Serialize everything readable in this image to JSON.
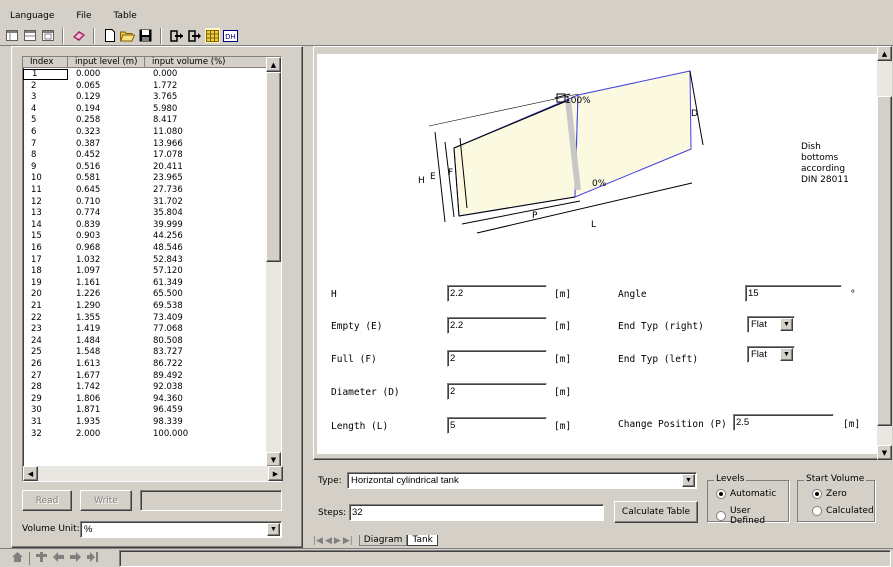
{
  "menu": [
    "Language",
    "File",
    "Table"
  ],
  "toolbar": {
    "icons": [
      "layout-grid-icon",
      "layout-table-icon",
      "layout-window-icon",
      "book-icon",
      "new-file-icon",
      "open-folder-icon",
      "save-icon",
      "export-icon",
      "import-icon",
      "table-grid-icon",
      "dh-icon"
    ],
    "dh_label": "DH"
  },
  "table": {
    "headers": [
      "Index",
      "input level (m)",
      "input volume (%)"
    ],
    "rows": [
      [
        "1",
        "0.000",
        "0.000"
      ],
      [
        "2",
        "0.065",
        "1.772"
      ],
      [
        "3",
        "0.129",
        "3.765"
      ],
      [
        "4",
        "0.194",
        "5.980"
      ],
      [
        "5",
        "0.258",
        "8.417"
      ],
      [
        "6",
        "0.323",
        "11.080"
      ],
      [
        "7",
        "0.387",
        "13.966"
      ],
      [
        "8",
        "0.452",
        "17.078"
      ],
      [
        "9",
        "0.516",
        "20.411"
      ],
      [
        "10",
        "0.581",
        "23.965"
      ],
      [
        "11",
        "0.645",
        "27.736"
      ],
      [
        "12",
        "0.710",
        "31.702"
      ],
      [
        "13",
        "0.774",
        "35.804"
      ],
      [
        "14",
        "0.839",
        "39.999"
      ],
      [
        "15",
        "0.903",
        "44.256"
      ],
      [
        "16",
        "0.968",
        "48.546"
      ],
      [
        "17",
        "1.032",
        "52.843"
      ],
      [
        "18",
        "1.097",
        "57.120"
      ],
      [
        "19",
        "1.161",
        "61.349"
      ],
      [
        "20",
        "1.226",
        "65.500"
      ],
      [
        "21",
        "1.290",
        "69.538"
      ],
      [
        "22",
        "1.355",
        "73.409"
      ],
      [
        "23",
        "1.419",
        "77.068"
      ],
      [
        "24",
        "1.484",
        "80.508"
      ],
      [
        "25",
        "1.548",
        "83.727"
      ],
      [
        "26",
        "1.613",
        "86.722"
      ],
      [
        "27",
        "1.677",
        "89.492"
      ],
      [
        "28",
        "1.742",
        "92.038"
      ],
      [
        "29",
        "1.806",
        "94.360"
      ],
      [
        "30",
        "1.871",
        "96.459"
      ],
      [
        "31",
        "1.935",
        "98.339"
      ],
      [
        "32",
        "2.000",
        "100.000"
      ]
    ]
  },
  "buttons": {
    "read": "Read",
    "write": "Write",
    "calculate": "Calculate Table"
  },
  "volume_unit": {
    "label": "Volume Unit:",
    "value": "%"
  },
  "diagram": {
    "label_100": "100%",
    "label_0": "0%",
    "H": "H",
    "E": "E",
    "F": "F",
    "D": "D",
    "P": "P",
    "L": "L",
    "note": [
      "Dish",
      "bottoms",
      "according",
      "DIN 28011"
    ]
  },
  "form": {
    "H": {
      "label": "H",
      "value": "2.2",
      "unit": "[m]"
    },
    "E": {
      "label": "Empty (E)",
      "value": "2.2",
      "unit": "[m]"
    },
    "F": {
      "label": "Full (F)",
      "value": "2",
      "unit": "[m]"
    },
    "D": {
      "label": "Diameter (D)",
      "value": "2",
      "unit": "[m]"
    },
    "L": {
      "label": "Length (L)",
      "value": "5",
      "unit": "[m]"
    },
    "angle": {
      "label": "Angle",
      "value": "15",
      "unit": "°"
    },
    "end_right": {
      "label": "End Typ (right)",
      "value": "Flat"
    },
    "end_left": {
      "label": "End Typ (left)",
      "value": "Flat"
    },
    "P": {
      "label": "Change Position (P)",
      "value": "2.5",
      "unit": "[m]"
    }
  },
  "controls": {
    "type_label": "Type:",
    "type_value": "Horizontal cylindrical tank",
    "steps_label": "Steps:",
    "steps_value": "32",
    "levels_title": "Levels",
    "levels_options": [
      "Automatic",
      "User Defined"
    ],
    "levels_selected": 0,
    "start_title": "Start Volume",
    "start_options": [
      "Zero",
      "Calculated"
    ],
    "start_selected": 0
  },
  "tabs": [
    "Diagram",
    "Tank"
  ],
  "active_tab": "Tank",
  "status_icons": [
    "home-icon",
    "tool-icon",
    "back-icon",
    "forward-icon",
    "end-icon"
  ]
}
